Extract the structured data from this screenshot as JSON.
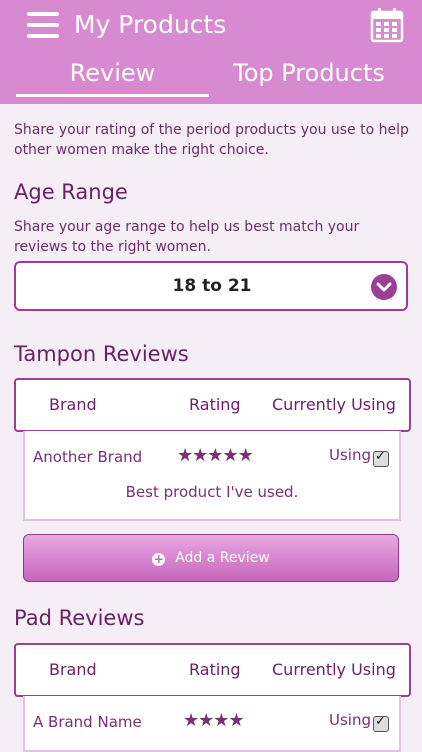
{
  "header": {
    "title": "My Products",
    "menu_icon": "hamburger-menu-icon",
    "calendar_icon": "calendar-icon",
    "tabs": [
      {
        "label": "Review",
        "active": true
      },
      {
        "label": "Top Products",
        "active": false
      }
    ]
  },
  "intro": "Share your rating of the period products you use to help other women make the right choice.",
  "age_range": {
    "title": "Age Range",
    "description": "Share your age range to help us best match your reviews to the right women.",
    "selected": "18 to 21",
    "chevron_icon": "chevron-down-icon"
  },
  "tampon_reviews": {
    "title": "Tampon Reviews",
    "columns": [
      "Brand",
      "Rating",
      "Currently Using"
    ],
    "rows": [
      {
        "brand": "Another Brand",
        "rating": 5,
        "using_label": "Using",
        "using": true,
        "comment": "Best product I've used."
      }
    ],
    "add_button_label": "Add a Review"
  },
  "pad_reviews": {
    "title": "Pad Reviews",
    "columns": [
      "Brand",
      "Rating",
      "Currently Using"
    ],
    "rows": [
      {
        "brand": "A Brand Name",
        "rating": 4,
        "using_label": "Using",
        "using": true
      }
    ]
  },
  "colors": {
    "header_bg": "#d88ad0",
    "accent": "#9b3f95",
    "text": "#6a1f66"
  }
}
